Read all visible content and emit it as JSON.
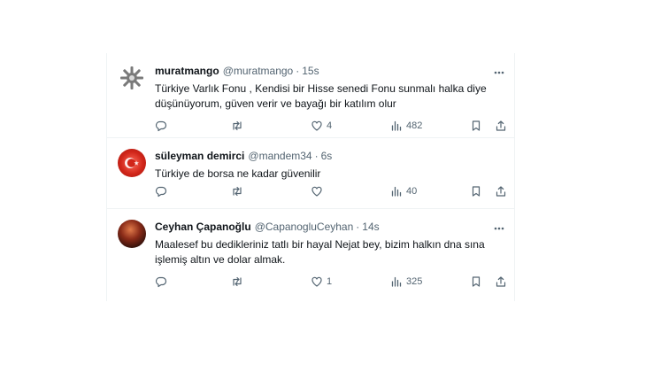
{
  "tweets": [
    {
      "name": "muratmango",
      "handle": "@muratmango",
      "separator": "·",
      "time": "15s",
      "text": "Türkiye Varlık Fonu , Kendisi bir Hisse senedi Fonu sunmalı halka diye düşünüyorum, güven verir ve bayağı bir katılım olur",
      "replies": "",
      "retweets": "",
      "likes": "4",
      "views": "482",
      "avatar_icon": "gear-flower-icon"
    },
    {
      "name": "süleyman demirci",
      "handle": "@mandem34",
      "separator": "·",
      "time": "6s",
      "text": "Türkiye de borsa ne kadar güvenilir",
      "replies": "",
      "retweets": "",
      "likes": "",
      "views": "40",
      "avatar_icon": "turkish-flag-emblem-icon"
    },
    {
      "name": "Ceyhan Çapanoğlu",
      "handle": "@CapanogluCeyhan",
      "separator": "·",
      "time": "14s",
      "text": "Maalesef bu dedikleriniz tatlı bir hayal Nejat bey, bizim halkın dna sına işlemiş altın ve dolar almak.",
      "replies": "",
      "retweets": "",
      "likes": "1",
      "views": "325",
      "avatar_icon": "profile-photo"
    }
  ],
  "colors": {
    "text": "#0f1419",
    "muted": "#536471",
    "divider": "#eff3f4"
  }
}
